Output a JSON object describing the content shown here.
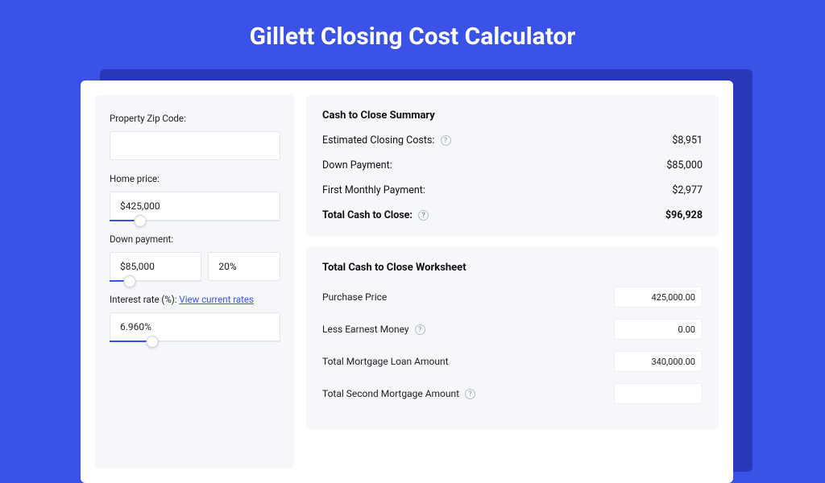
{
  "title": "Gillett Closing Cost Calculator",
  "sidebar": {
    "zip_label": "Property Zip Code:",
    "zip_value": "",
    "price_label": "Home price:",
    "price_value": "$425,000",
    "price_slider_pct": 18,
    "down_label": "Down payment:",
    "down_amount": "$85,000",
    "down_pct": "20%",
    "down_slider_pct": 22,
    "rate_label": "Interest rate (%): ",
    "rate_link": "View current rates",
    "rate_value": "6.960%",
    "rate_slider_pct": 25
  },
  "summary": {
    "title": "Cash to Close Summary",
    "rows": [
      {
        "label": "Estimated Closing Costs:",
        "value": "$8,951",
        "help": true
      },
      {
        "label": "Down Payment:",
        "value": "$85,000",
        "help": false
      },
      {
        "label": "First Monthly Payment:",
        "value": "$2,977",
        "help": false
      }
    ],
    "total_label": "Total Cash to Close:",
    "total_value": "$96,928"
  },
  "worksheet": {
    "title": "Total Cash to Close Worksheet",
    "rows": [
      {
        "label": "Purchase Price",
        "value": "425,000.00",
        "help": false
      },
      {
        "label": "Less Earnest Money",
        "value": "0.00",
        "help": true
      },
      {
        "label": "Total Mortgage Loan Amount",
        "value": "340,000.00",
        "help": false
      },
      {
        "label": "Total Second Mortgage Amount",
        "value": "",
        "help": true
      }
    ]
  }
}
